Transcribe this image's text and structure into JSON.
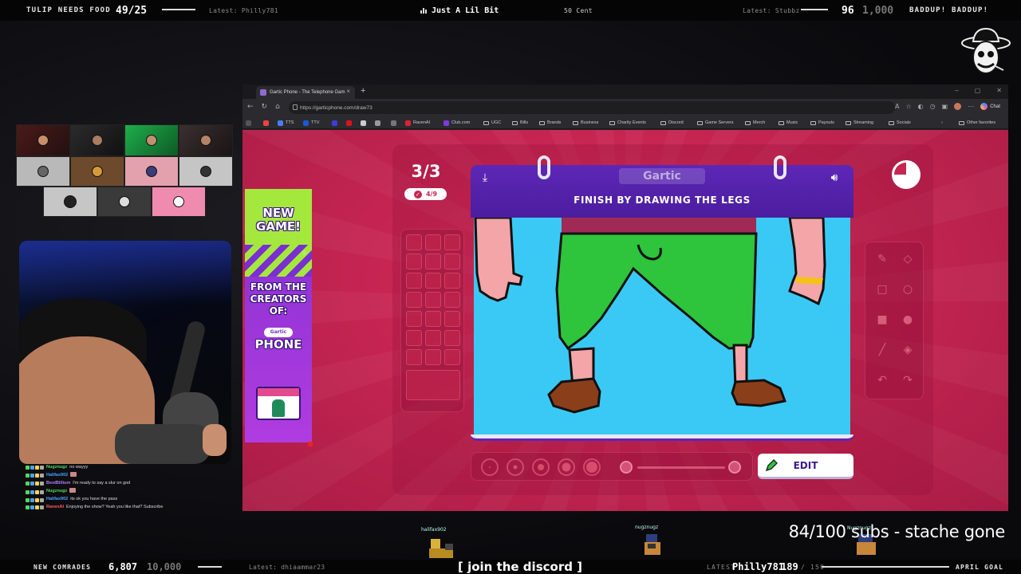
{
  "topbar": {
    "left_label": "TULIP NEEDS FOOD",
    "left_value": "49",
    "left_goal": "/25",
    "latest_left": "Latest: Philly781",
    "now_playing_title": "Just A Lil Bit",
    "now_playing_artist": "50 Cent",
    "latest_right": "Latest: Stubbz",
    "right_value": "96",
    "right_goal": "1,000",
    "right_label": "BADDUP! BADDUP!"
  },
  "bottombar": {
    "comrades_label": "NEW COMRADES",
    "comrades_value": "6,807",
    "comrades_goal": "10,000",
    "latest_left": "Latest: dhiaammar23",
    "discord": "[  join the discord  ]",
    "latest_right_label": "LATEST",
    "latest_right_user": "Philly781",
    "goal_value": "189",
    "goal_max": "/ 150",
    "goal_label": "APRIL GOAL"
  },
  "overlay": {
    "subgoal": "84/100 subs - stache gone",
    "sprite_name_1": "halifax902",
    "sprite_name_2": "nugznugz",
    "sprite_name_3": "Nugznugz"
  },
  "chat": [
    {
      "user": "Nugznugz",
      "msg": "no wayyy",
      "color": "#58d65c"
    },
    {
      "user": "Halifax902",
      "msg": "",
      "color": "#4aa0ff"
    },
    {
      "user": "BestBillium",
      "msg": "I'm ready to say a slur on god",
      "color": "#b37bff"
    },
    {
      "user": "Nugznugz",
      "msg": "",
      "color": "#58d65c"
    },
    {
      "user": "Halifax902",
      "msg": "its ok you have the pass",
      "color": "#4aa0ff"
    },
    {
      "user": "RavenAI",
      "msg": "Enjoying the show? Yeah you like that? Subscribe",
      "color": "#ff5a5a"
    }
  ],
  "browser": {
    "tab_title": "Gartic Phone - The Telephone Gam",
    "url": "https://garticphone.com/draw73",
    "chat_button": "Chat",
    "bookmarks": [
      "TTS",
      "TTV",
      "RavenAI",
      "Club.com",
      "UGC",
      "Bills",
      "Brands",
      "Business",
      "Charity Events",
      "Discord",
      "Game Servers",
      "Merch",
      "Music",
      "Payouts",
      "Streaming",
      "Socials"
    ],
    "other_favorites": "Other favorites"
  },
  "game": {
    "round": "3/3",
    "progress": "4/9",
    "logo": "Gartic",
    "instruction": "FINISH BY DRAWING THE LEGS",
    "edit_label": "EDIT",
    "timer_remaining_fraction": 0.75
  },
  "ad": {
    "headline": "NEW GAME!",
    "subline": "FROM THE CREATORS OF:",
    "brand_small": "Gartic",
    "brand_big": "PHONE"
  },
  "colors": {
    "page_pink": "#c72552",
    "card_purple": "#5d27b7",
    "canvas_blue": "#3ac9f5",
    "pants_green": "#2ec43c",
    "skin": "#f3a5a8",
    "shoes": "#8a3f1a"
  }
}
